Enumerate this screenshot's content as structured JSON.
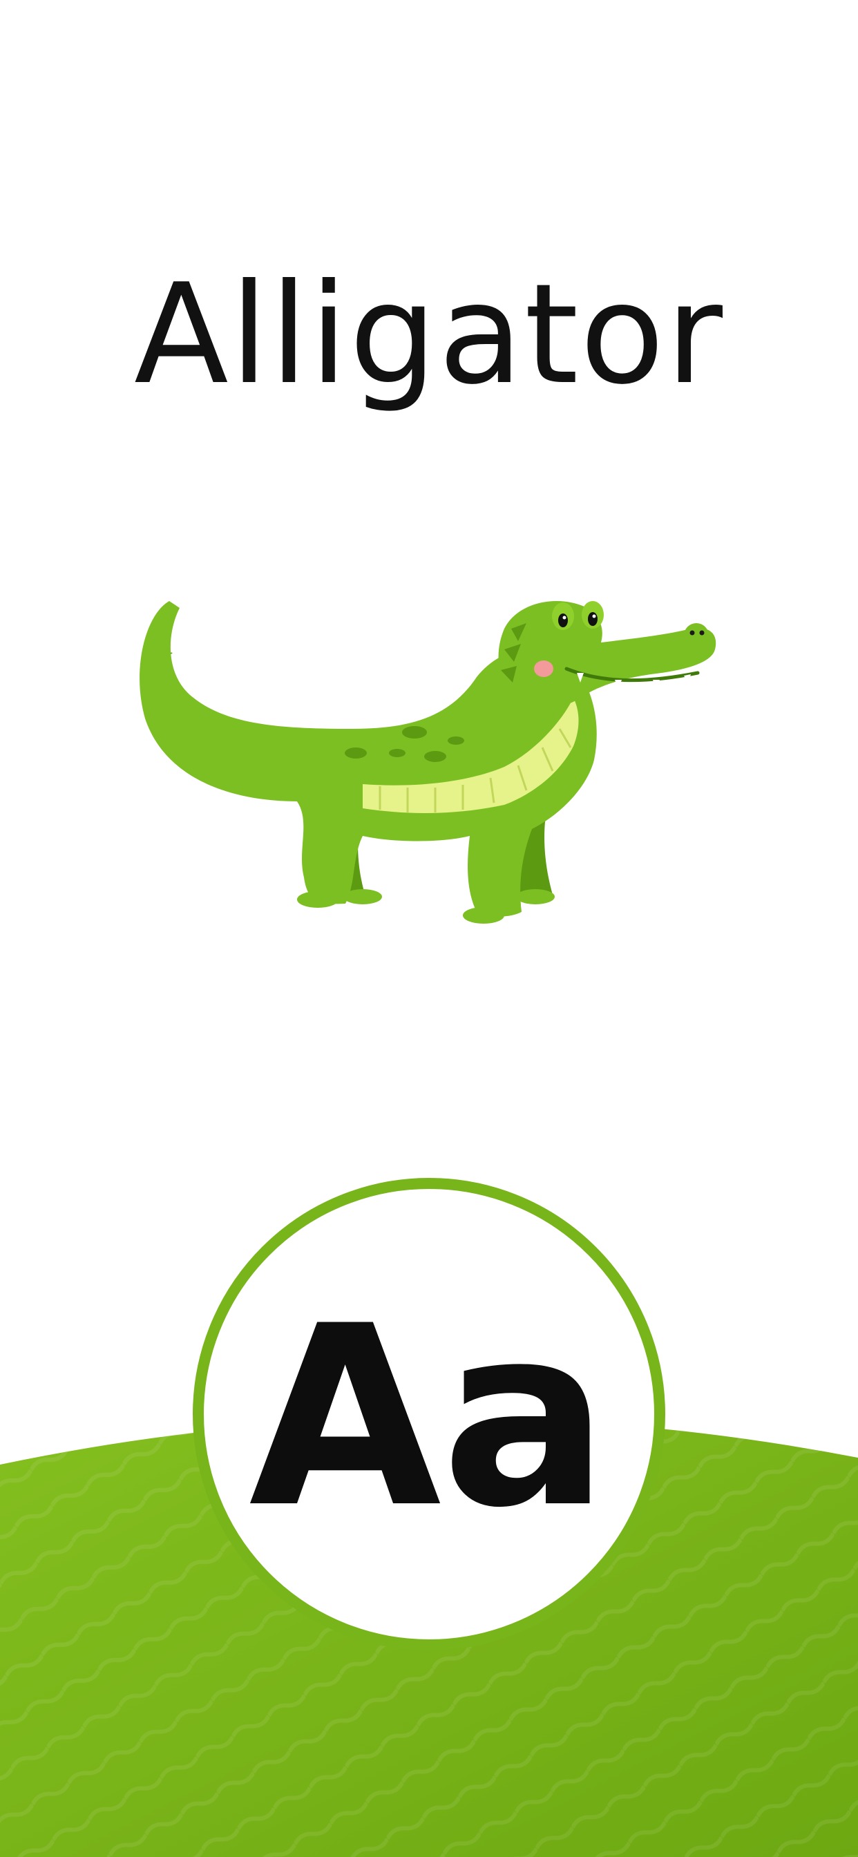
{
  "card": {
    "word": "Alligator",
    "letter": "Aa",
    "illustration_icon": "alligator-illustration",
    "colors": {
      "background": "#ffffff",
      "accent_green": "#78b51a",
      "ground_green": "#7cb518",
      "text": "#111111"
    }
  }
}
